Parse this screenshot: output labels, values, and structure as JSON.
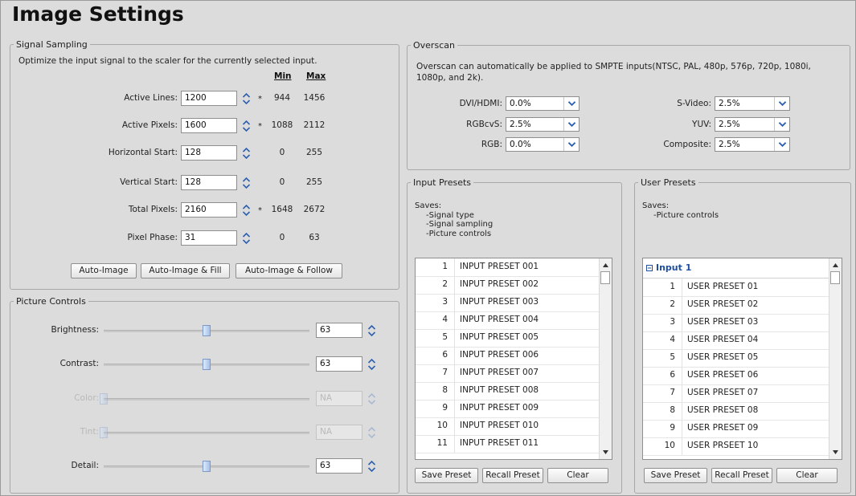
{
  "title": "Image Settings",
  "signal_sampling": {
    "legend": "Signal Sampling",
    "description": "Optimize the input signal to the scaler for the currently selected input.",
    "min_header": "Min",
    "max_header": "Max",
    "rows": [
      {
        "label": "Active Lines:",
        "value": "1200",
        "star": "*",
        "min": "944",
        "max": "1456"
      },
      {
        "label": "Active Pixels:",
        "value": "1600",
        "star": "*",
        "min": "1088",
        "max": "2112"
      },
      {
        "label": "Horizontal Start:",
        "value": "128",
        "star": "",
        "min": "0",
        "max": "255"
      },
      {
        "label": "Vertical Start:",
        "value": "128",
        "star": "",
        "min": "0",
        "max": "255"
      },
      {
        "label": "Total Pixels:",
        "value": "2160",
        "star": "*",
        "min": "1648",
        "max": "2672"
      },
      {
        "label": "Pixel Phase:",
        "value": "31",
        "star": "",
        "min": "0",
        "max": "63"
      }
    ],
    "buttons": [
      "Auto-Image",
      "Auto-Image & Fill",
      "Auto-Image & Follow"
    ]
  },
  "picture_controls": {
    "legend": "Picture Controls",
    "rows": [
      {
        "label": "Brightness:",
        "value": "63",
        "level": 0.5,
        "enabled": true
      },
      {
        "label": "Contrast:",
        "value": "63",
        "level": 0.5,
        "enabled": true
      },
      {
        "label": "Color:",
        "value": "NA",
        "level": 0.0,
        "enabled": false
      },
      {
        "label": "Tint:",
        "value": "NA",
        "level": 0.0,
        "enabled": false
      },
      {
        "label": "Detail:",
        "value": "63",
        "level": 0.5,
        "enabled": true
      }
    ]
  },
  "overscan": {
    "legend": "Overscan",
    "description_line1": "Overscan can automatically be applied to SMPTE inputs(NTSC, PAL, 480p, 576p, 720p, 1080i,",
    "description_line2": "1080p, and 2k).",
    "left": [
      {
        "label": "DVI/HDMI:",
        "value": "0.0%"
      },
      {
        "label": "RGBcvS:",
        "value": "2.5%"
      },
      {
        "label": "RGB:",
        "value": "0.0%"
      }
    ],
    "right": [
      {
        "label": "S-Video:",
        "value": "2.5%"
      },
      {
        "label": "YUV:",
        "value": "2.5%"
      },
      {
        "label": "Composite:",
        "value": "2.5%"
      }
    ]
  },
  "input_presets": {
    "legend": "Input Presets",
    "saves": [
      "Saves:",
      "-Signal type",
      "-Signal sampling",
      "-Picture controls"
    ],
    "items": [
      {
        "n": "1",
        "name": "INPUT PRESET 001"
      },
      {
        "n": "2",
        "name": "INPUT PRESET 002"
      },
      {
        "n": "3",
        "name": "INPUT PRESET 003"
      },
      {
        "n": "4",
        "name": "INPUT PRESET 004"
      },
      {
        "n": "5",
        "name": "INPUT PRESET 005"
      },
      {
        "n": "6",
        "name": "INPUT PRESET 006"
      },
      {
        "n": "7",
        "name": "INPUT PRESET 007"
      },
      {
        "n": "8",
        "name": "INPUT PRESET 008"
      },
      {
        "n": "9",
        "name": "INPUT PRESET 009"
      },
      {
        "n": "10",
        "name": "INPUT PRESET 010"
      },
      {
        "n": "11",
        "name": "INPUT PRESET 011"
      }
    ],
    "buttons": [
      "Save Preset",
      "Recall Preset",
      "Clear"
    ]
  },
  "user_presets": {
    "legend": "User Presets",
    "saves": [
      "Saves:",
      "-Picture controls"
    ],
    "group": "Input 1",
    "items": [
      {
        "n": "1",
        "name": "USER PRESET 01"
      },
      {
        "n": "2",
        "name": "USER PRESET 02"
      },
      {
        "n": "3",
        "name": "USER PRESET 03"
      },
      {
        "n": "4",
        "name": "USER PRESET 04"
      },
      {
        "n": "5",
        "name": "USER PRESET 05"
      },
      {
        "n": "6",
        "name": "USER PRESET 06"
      },
      {
        "n": "7",
        "name": "USER PRESET 07"
      },
      {
        "n": "8",
        "name": "USER PRESET 08"
      },
      {
        "n": "9",
        "name": "USER PRESET 09"
      },
      {
        "n": "10",
        "name": "USER PRSEET 10"
      }
    ],
    "buttons": [
      "Save Preset",
      "Recall Preset",
      "Clear"
    ]
  },
  "colors": {
    "group_header": "#1f4f9e",
    "slider_thumb": "#a7c1ea",
    "dropdown_arrow": "#2a5fb0"
  }
}
